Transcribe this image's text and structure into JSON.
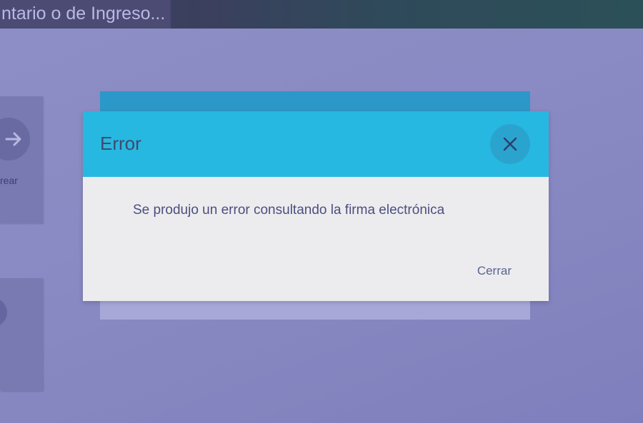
{
  "window": {
    "title": "ntario o de Ingreso..."
  },
  "side_cards": [
    {
      "icon": "arrow-right-icon",
      "label": "rear"
    },
    {
      "icon": "circle-icon",
      "label": ""
    }
  ],
  "dialog": {
    "title": "Error",
    "close_icon": "close-icon",
    "message": "Se produjo un error consultando la firma electrónica",
    "action_label": "Cerrar"
  },
  "colors": {
    "header_accent": "#27b8e1",
    "overlay": "#8a8ac4",
    "dialog_body": "#ececef"
  }
}
